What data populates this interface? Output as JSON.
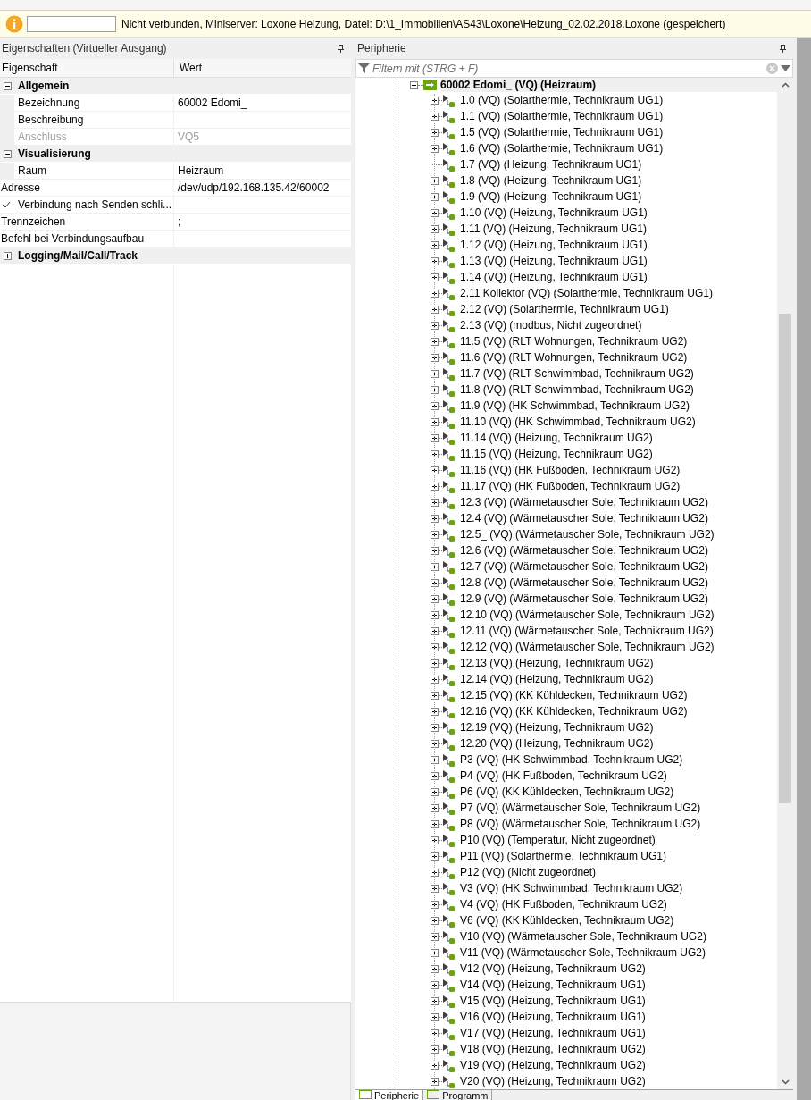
{
  "info_bar": {
    "message": "Nicht verbunden, Miniserver: Loxone Heizung, Datei: D:\\1_Immobilien\\AS43\\Loxone\\Heizung_02.02.2018.Loxone (gespeichert)"
  },
  "properties_panel": {
    "title": "Eigenschaften (Virtueller Ausgang)",
    "columns": [
      "Eigenschaft",
      "Wert"
    ],
    "rows": [
      {
        "kind": "category",
        "label": "Allgemein",
        "expanded": true
      },
      {
        "kind": "property",
        "label": "Bezeichnung",
        "value": "60002 Edomi_",
        "indented": true,
        "disabled": false
      },
      {
        "kind": "property",
        "label": "Beschreibung",
        "indented": true,
        "disabled": false
      },
      {
        "kind": "property",
        "label": "Anschluss",
        "value": "VQ5",
        "indented": true,
        "disabled": true
      },
      {
        "kind": "category",
        "label": "Visualisierung",
        "expanded": true
      },
      {
        "kind": "property",
        "label": "Raum",
        "value": "Heizraum",
        "indented": true,
        "disabled": false
      },
      {
        "kind": "property",
        "label": "Adresse",
        "value": "/dev/udp/192.168.135.42/60002",
        "indented": false,
        "disabled": false
      },
      {
        "kind": "checkbox",
        "label": "Verbindung nach Senden schli...",
        "checked": true
      },
      {
        "kind": "property",
        "label": "Trennzeichen",
        "value": ";",
        "indented": false,
        "disabled": false
      },
      {
        "kind": "property",
        "label": "Befehl bei Verbindungsaufbau",
        "indented": false,
        "disabled": false
      },
      {
        "kind": "category",
        "label": "Logging/Mail/Call/Track",
        "expanded": false
      }
    ]
  },
  "periphery_panel": {
    "title": "Peripherie",
    "filter": {
      "placeholder": "Filtern mit (STRG + F)"
    },
    "root": {
      "label": "60002 Edomi_ (VQ) (Heizraum)",
      "expanded": true,
      "selected": true
    },
    "items": [
      {
        "label": "1.0 (VQ) (Solarthermie, Technikraum UG1)",
        "expandable": true
      },
      {
        "label": "1.1 (VQ) (Solarthermie, Technikraum UG1)",
        "expandable": true
      },
      {
        "label": "1.5 (VQ) (Solarthermie, Technikraum UG1)",
        "expandable": true
      },
      {
        "label": "1.6 (VQ) (Solarthermie, Technikraum UG1)",
        "expandable": true
      },
      {
        "label": "1.7 (VQ) (Heizung, Technikraum UG1)",
        "expandable": false
      },
      {
        "label": "1.8 (VQ) (Heizung, Technikraum UG1)",
        "expandable": true
      },
      {
        "label": "1.9 (VQ) (Heizung, Technikraum UG1)",
        "expandable": true
      },
      {
        "label": "1.10 (VQ) (Heizung, Technikraum UG1)",
        "expandable": true
      },
      {
        "label": "1.11 (VQ) (Heizung, Technikraum UG1)",
        "expandable": true
      },
      {
        "label": "1.12 (VQ) (Heizung, Technikraum UG1)",
        "expandable": true
      },
      {
        "label": "1.13 (VQ) (Heizung, Technikraum UG1)",
        "expandable": true
      },
      {
        "label": "1.14 (VQ) (Heizung, Technikraum UG1)",
        "expandable": true
      },
      {
        "label": "2.11 Kollektor (VQ) (Solarthermie, Technikraum UG1)",
        "expandable": true
      },
      {
        "label": "2.12 (VQ) (Solarthermie, Technikraum UG1)",
        "expandable": true
      },
      {
        "label": "2.13 (VQ) (modbus, Nicht zugeordnet)",
        "expandable": true
      },
      {
        "label": "11.5 (VQ) (RLT Wohnungen, Technikraum UG2)",
        "expandable": true
      },
      {
        "label": "11.6 (VQ) (RLT Wohnungen, Technikraum UG2)",
        "expandable": true
      },
      {
        "label": "11.7 (VQ) (RLT Schwimmbad, Technikraum UG2)",
        "expandable": true
      },
      {
        "label": "11.8 (VQ) (RLT Schwimmbad, Technikraum UG2)",
        "expandable": true
      },
      {
        "label": "11.9 (VQ) (HK Schwimmbad, Technikraum UG2)",
        "expandable": true
      },
      {
        "label": "11.10 (VQ) (HK Schwimmbad, Technikraum UG2)",
        "expandable": true
      },
      {
        "label": "11.14 (VQ) (Heizung, Technikraum UG2)",
        "expandable": true
      },
      {
        "label": "11.15 (VQ) (Heizung, Technikraum UG2)",
        "expandable": true
      },
      {
        "label": "11.16 (VQ) (HK Fußboden, Technikraum UG2)",
        "expandable": true
      },
      {
        "label": "11.17 (VQ) (HK Fußboden, Technikraum UG2)",
        "expandable": true
      },
      {
        "label": "12.3 (VQ) (Wärmetauscher Sole, Technikraum UG2)",
        "expandable": true
      },
      {
        "label": "12.4 (VQ) (Wärmetauscher Sole, Technikraum UG2)",
        "expandable": true
      },
      {
        "label": "12.5_ (VQ) (Wärmetauscher Sole, Technikraum UG2)",
        "expandable": true
      },
      {
        "label": "12.6 (VQ) (Wärmetauscher Sole, Technikraum UG2)",
        "expandable": true
      },
      {
        "label": "12.7 (VQ) (Wärmetauscher Sole, Technikraum UG2)",
        "expandable": true
      },
      {
        "label": "12.8 (VQ) (Wärmetauscher Sole, Technikraum UG2)",
        "expandable": true
      },
      {
        "label": "12.9 (VQ) (Wärmetauscher Sole, Technikraum UG2)",
        "expandable": true
      },
      {
        "label": "12.10 (VQ) (Wärmetauscher Sole, Technikraum UG2)",
        "expandable": true
      },
      {
        "label": "12.11 (VQ) (Wärmetauscher Sole, Technikraum UG2)",
        "expandable": true
      },
      {
        "label": "12.12 (VQ) (Wärmetauscher Sole, Technikraum UG2)",
        "expandable": true
      },
      {
        "label": "12.13 (VQ) (Heizung, Technikraum UG2)",
        "expandable": true
      },
      {
        "label": "12.14 (VQ) (Heizung, Technikraum UG2)",
        "expandable": true
      },
      {
        "label": "12.15 (VQ) (KK Kühldecken, Technikraum UG2)",
        "expandable": true
      },
      {
        "label": "12.16 (VQ) (KK Kühldecken, Technikraum UG2)",
        "expandable": true
      },
      {
        "label": "12.19 (VQ) (Heizung, Technikraum UG2)",
        "expandable": true
      },
      {
        "label": "12.20 (VQ) (Heizung, Technikraum UG2)",
        "expandable": true
      },
      {
        "label": "P3 (VQ) (HK Schwimmbad, Technikraum UG2)",
        "expandable": true
      },
      {
        "label": "P4 (VQ) (HK Fußboden, Technikraum UG2)",
        "expandable": true
      },
      {
        "label": "P6 (VQ) (KK Kühldecken, Technikraum UG2)",
        "expandable": true
      },
      {
        "label": "P7 (VQ) (Wärmetauscher Sole, Technikraum UG2)",
        "expandable": true
      },
      {
        "label": "P8 (VQ) (Wärmetauscher Sole, Technikraum UG2)",
        "expandable": true
      },
      {
        "label": "P10 (VQ) (Temperatur, Nicht zugeordnet)",
        "expandable": true
      },
      {
        "label": "P11 (VQ) (Solarthermie, Technikraum UG1)",
        "expandable": true
      },
      {
        "label": "P12 (VQ) (Nicht zugeordnet)",
        "expandable": true
      },
      {
        "label": "V3 (VQ) (HK Schwimmbad, Technikraum UG2)",
        "expandable": true
      },
      {
        "label": "V4 (VQ) (HK Fußboden, Technikraum UG2)",
        "expandable": true
      },
      {
        "label": "V6 (VQ) (KK Kühldecken, Technikraum UG2)",
        "expandable": true
      },
      {
        "label": "V10 (VQ) (Wärmetauscher Sole, Technikraum UG2)",
        "expandable": true
      },
      {
        "label": "V11 (VQ) (Wärmetauscher Sole, Technikraum UG2)",
        "expandable": true
      },
      {
        "label": "V12 (VQ) (Heizung, Technikraum UG2)",
        "expandable": true
      },
      {
        "label": "V14 (VQ) (Heizung, Technikraum UG1)",
        "expandable": true
      },
      {
        "label": "V15 (VQ) (Heizung, Technikraum UG1)",
        "expandable": true
      },
      {
        "label": "V16 (VQ) (Heizung, Technikraum UG1)",
        "expandable": true
      },
      {
        "label": "V17 (VQ) (Heizung, Technikraum UG1)",
        "expandable": true
      },
      {
        "label": "V18 (VQ) (Heizung, Technikraum UG2)",
        "expandable": true
      },
      {
        "label": "V19 (VQ) (Heizung, Technikraum UG2)",
        "expandable": true
      },
      {
        "label": "V20 (VQ) (Heizung, Technikraum UG2)",
        "expandable": true
      }
    ],
    "bottom_tabs": [
      {
        "label": "Peripherie",
        "selected": true
      },
      {
        "label": "Programm",
        "selected": false
      }
    ]
  }
}
